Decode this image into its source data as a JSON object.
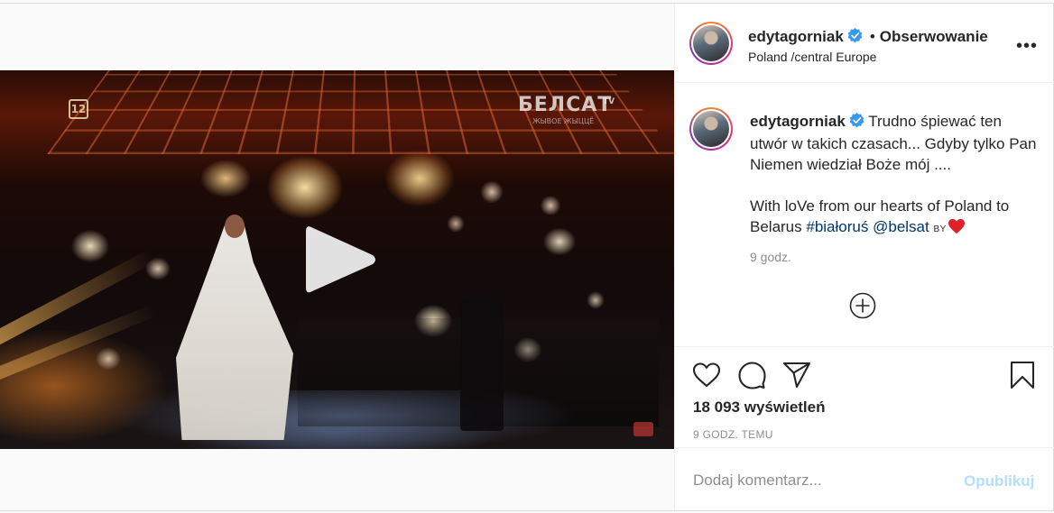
{
  "post": {
    "username": "edytagorniak",
    "follow_separator": "•",
    "follow_label": "Obserwowanie",
    "location": "Poland /central Europe",
    "more_label": "•••",
    "caption": {
      "line1": "Trudno śpiewać ten utwór w takich czasach... Gdyby tylko Pan Niemen wiedział Boże mój ....",
      "line2_text": "With loVe from our hearts of Poland to Belarus",
      "hashtag": "#białoruś",
      "mention": "@belsat",
      "by": "BY"
    },
    "caption_time": "9 godz.",
    "views_count": "18 093",
    "views_label": "wyświetleń",
    "time_ago": "9 GODZ. TEMU"
  },
  "video": {
    "channel_badge": "12",
    "watermark": "БЕЛСАТ",
    "watermark_sup": "TV",
    "watermark_sub": "ЖЫВОЕ ЖЫЦЦЁ"
  },
  "comment": {
    "placeholder": "Dodaj komentarz...",
    "publish_label": "Opublikuj"
  },
  "icons": {
    "verified": "verified-badge-icon",
    "like": "heart-icon",
    "comment": "comment-bubble-icon",
    "share": "paper-plane-icon",
    "save": "bookmark-icon",
    "add": "plus-circle-icon",
    "play": "play-icon"
  },
  "colors": {
    "verified_blue": "#3897f0",
    "link": "#00376b",
    "heart_emoji": "#e0202a",
    "publish_disabled": "#b2dffc",
    "muted": "#8e8e8e"
  }
}
